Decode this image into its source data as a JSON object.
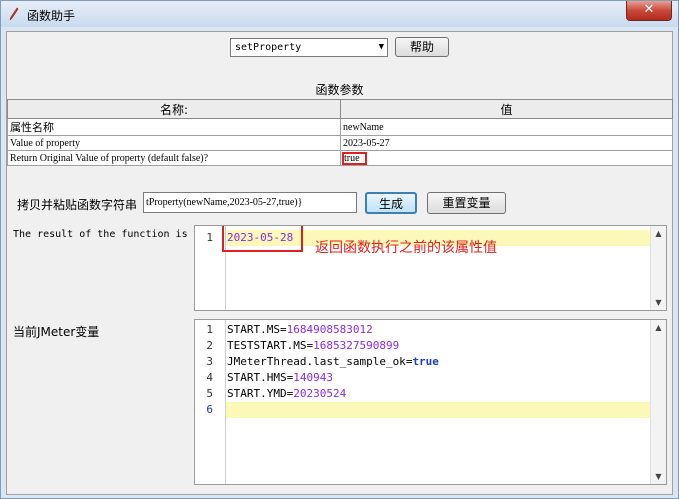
{
  "window": {
    "title": "函数助手",
    "close_glyph": "✕"
  },
  "function_select": {
    "value": "setProperty"
  },
  "buttons": {
    "help": "帮助",
    "generate": "生成",
    "reset_vars": "重置变量"
  },
  "params": {
    "section_title": "函数参数",
    "headers": [
      "名称:",
      "值"
    ],
    "rows": [
      {
        "name": "属性名称",
        "value": "newName"
      },
      {
        "name": "Value of property",
        "value": "2023-05-27"
      },
      {
        "name": "Return Original Value of property (default false)?",
        "value": "true"
      }
    ]
  },
  "copy": {
    "label": "拷贝并粘贴函数字符串",
    "value": "tProperty(newName,2023-05-27,true)}"
  },
  "result": {
    "label": "The result of the function is",
    "lines": [
      "1"
    ],
    "value": "2023-05-28",
    "annotation": "返回函数执行之前的该属性值"
  },
  "jmeter_vars": {
    "label": "当前JMeter变量",
    "line_numbers": [
      "1",
      "2",
      "3",
      "4",
      "5",
      "6"
    ],
    "entries": [
      {
        "key": "START.MS",
        "value": "1684908583012"
      },
      {
        "key": "TESTSTART.MS",
        "value": "1685327590899"
      },
      {
        "key": "JMeterThread.last_sample_ok",
        "value": "true"
      },
      {
        "key": "START.HMS",
        "value": "140943"
      },
      {
        "key": "START.YMD",
        "value": "20230524"
      }
    ]
  },
  "colors": {
    "highlight_red": "#e02020",
    "current_line": "#fbf8b8",
    "value_purple": "#8a2be2"
  },
  "icons": {
    "app": "feather-pen-icon",
    "scroll_up": "▲",
    "scroll_down": "▼",
    "dropdown": "▼"
  }
}
